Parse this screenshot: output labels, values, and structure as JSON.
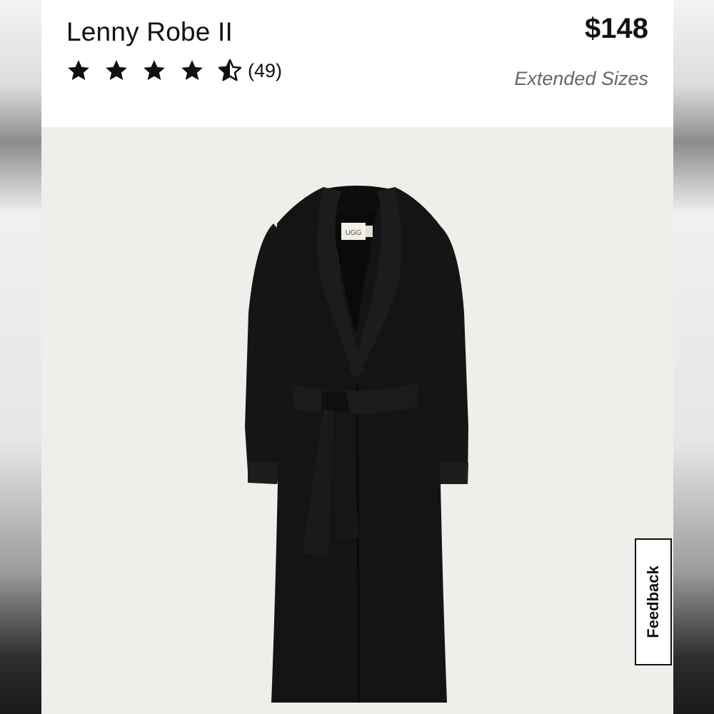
{
  "product": {
    "title": "Lenny Robe II",
    "price": "$148",
    "review_count": "(49)",
    "rating": 4.5,
    "extended_sizes_label": "Extended Sizes",
    "brand_tag": "UGG"
  },
  "feedback_tab": {
    "label": "Feedback"
  },
  "colors": {
    "text": "#111111",
    "extended_sizes": "#6d655c",
    "photo_background": "#efeeeb",
    "robe": "#141414"
  },
  "icons": [
    "star-icon",
    "half-star-icon"
  ]
}
